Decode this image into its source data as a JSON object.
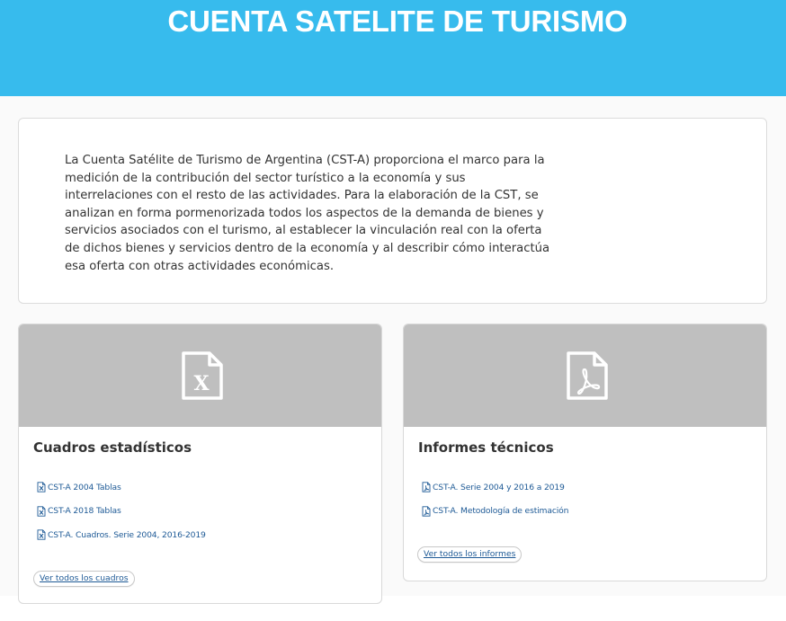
{
  "header": {
    "title": "CUENTA SATELITE DE TURISMO",
    "background_color": "#37bbed"
  },
  "intro": {
    "text": "La Cuenta Satélite de Turismo de Argentina (CST-A) proporciona el marco para la medición de la contribución del sector turístico a la economía y sus interrelaciones con el resto de las actividades. Para la elaboración de la CST, se analizan en forma pormenorizada todos los aspectos de la demanda de bienes y servicios asociados con el turismo, al establecer la vinculación real con la oferta de dichos bienes y servicios dentro de la economía y al describir cómo interactúa esa oferta con otras actividades económicas."
  },
  "cards": [
    {
      "title": "Cuadros estadísticos",
      "media_icon": "excel-file-icon",
      "links": [
        {
          "label": "CST-A 2004 Tablas",
          "icon": "excel-file-icon"
        },
        {
          "label": "CST-A 2018 Tablas",
          "icon": "excel-file-icon"
        },
        {
          "label": "CST-A. Cuadros. Serie 2004, 2016-2019",
          "icon": "excel-file-icon"
        }
      ],
      "more_label": "Ver todos los cuadros"
    },
    {
      "title": "Informes técnicos",
      "media_icon": "pdf-file-icon",
      "links": [
        {
          "label": "CST-A. Serie 2004 y 2016 a 2019",
          "icon": "pdf-file-icon"
        },
        {
          "label": "CST-A. Metodología de estimación",
          "icon": "pdf-file-icon"
        }
      ],
      "more_label": "Ver todos los informes"
    }
  ],
  "colors": {
    "link": "#1e5a96",
    "media_background": "#bfbfbf"
  }
}
